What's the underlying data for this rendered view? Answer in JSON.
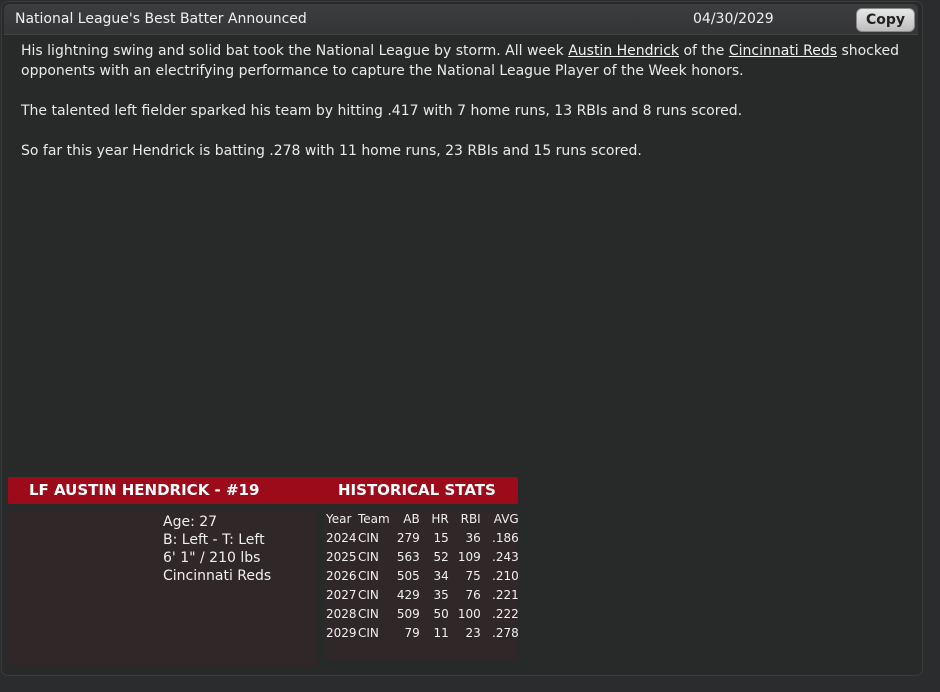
{
  "header": {
    "headline": "National League's Best Batter Announced",
    "date": "04/30/2029",
    "copy_label": "Copy"
  },
  "article": {
    "p1_before": "His lightning swing and solid bat took the National League by storm. All week ",
    "player_link": "Austin Hendrick",
    "p1_middle": " of the ",
    "team_link": "Cincinnati Reds",
    "p1_after": " shocked opponents with an electrifying performance to capture the National League Player of the Week honors.",
    "p2": "The talented left fielder sparked his team by hitting .417 with 7 home runs, 13 RBIs and 8 runs scored.",
    "p3": "So far this year Hendrick is batting .278 with 11 home runs, 23 RBIs and 15 runs scored."
  },
  "player": {
    "title": "LF AUSTIN HENDRICK - #19",
    "age": "Age: 27",
    "bats_throws": "B: Left - T: Left",
    "size": "6' 1\" / 210 lbs",
    "team": "Cincinnati Reds"
  },
  "historical": {
    "title": "HISTORICAL STATS",
    "columns": [
      "Year",
      "Team",
      "AB",
      "HR",
      "RBI",
      "AVG"
    ],
    "rows": [
      [
        "2024",
        "CIN",
        "279",
        "15",
        "36",
        ".186"
      ],
      [
        "2025",
        "CIN",
        "563",
        "52",
        "109",
        ".243"
      ],
      [
        "2026",
        "CIN",
        "505",
        "34",
        "75",
        ".210"
      ],
      [
        "2027",
        "CIN",
        "429",
        "35",
        "76",
        ".221"
      ],
      [
        "2028",
        "CIN",
        "509",
        "50",
        "100",
        ".222"
      ],
      [
        "2029",
        "CIN",
        "79",
        "11",
        "23",
        ".278"
      ]
    ]
  },
  "colors": {
    "accent_red": "#9b0b1a",
    "panel_bg": "#282929",
    "box_bg": "#2f2728"
  }
}
